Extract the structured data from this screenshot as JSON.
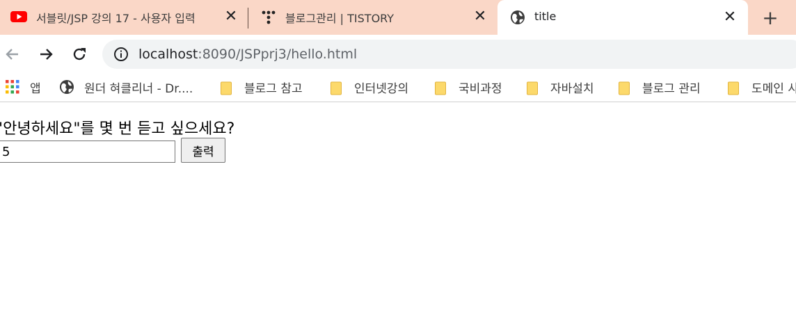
{
  "tabs": [
    {
      "title": "서블릿/JSP 강의 17 - 사용자 입력",
      "icon": "youtube-icon",
      "active": false
    },
    {
      "title": "블로그관리 | TISTORY",
      "icon": "tistory-icon",
      "active": false
    },
    {
      "title": "title",
      "icon": "globe-icon",
      "active": true
    }
  ],
  "toolbar": {
    "url_host": "localhost",
    "url_rest": ":8090/JSPprj3/hello.html"
  },
  "bookmarks": [
    {
      "label": "앱",
      "icon": "apps-grid-icon"
    },
    {
      "label": "원더 혀클리너 - Dr....",
      "icon": "globe-icon"
    },
    {
      "label": "블로그 참고",
      "icon": "folder-icon"
    },
    {
      "label": "인터넷강의",
      "icon": "folder-icon"
    },
    {
      "label": "국비과정",
      "icon": "folder-icon"
    },
    {
      "label": "자바설치",
      "icon": "folder-icon"
    },
    {
      "label": "블로그 관리",
      "icon": "folder-icon"
    },
    {
      "label": "도메인 사",
      "icon": "folder-icon"
    }
  ],
  "page": {
    "question": "\"안녕하세요\"를 몇 번 듣고 싶으세요?",
    "count_value": "5",
    "submit_label": "출력"
  },
  "colors": {
    "tabstrip_bg": "#fad7c7",
    "youtube_red": "#ff0000",
    "folder_yellow": "#fcd96b"
  }
}
